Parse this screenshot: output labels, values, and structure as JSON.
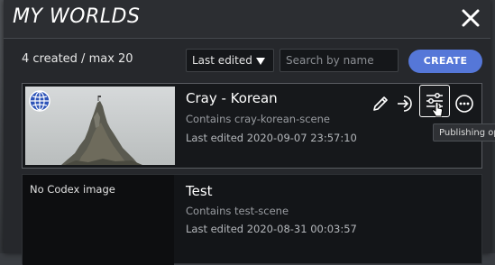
{
  "dialog": {
    "title": "MY WORLDS",
    "close_icon": "close-icon"
  },
  "toolbar": {
    "count_text": "4 created / max 20",
    "sort_value": "Last edited",
    "search_placeholder": "Search by name",
    "create_label": "CREATE"
  },
  "worlds": [
    {
      "title": "Cray - Korean",
      "contains": "Contains cray-korean-scene",
      "last_edited": "Last edited 2020-09-07 23:57:10",
      "thumbnail": "rock-pinnacle-photo",
      "public_icon": "globe-icon"
    },
    {
      "title": "Test",
      "contains": "Contains test-scene",
      "last_edited": "Last edited 2020-08-31 00:03:57",
      "no_image_text": "No Codex image"
    }
  ],
  "actions": {
    "edit_icon": "pencil-icon",
    "enter_icon": "enter-icon",
    "publishing_icon": "sliders-icon",
    "more_icon": "more-icon"
  },
  "tooltip": {
    "text": "Publishing op"
  },
  "colors": {
    "accent": "#5577d8",
    "panel": "#26282c",
    "text": "#ffffff",
    "muted": "#9a9da2"
  }
}
